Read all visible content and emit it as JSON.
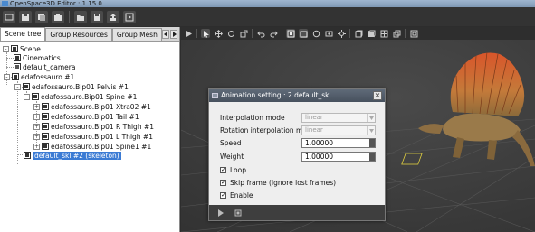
{
  "window": {
    "title": "OpenSpace3D Editor : 1.15.0"
  },
  "toolbar": {
    "buttons": [
      "scene-icon",
      "save-icon",
      "save-as-icon",
      "import-icon",
      "open-folder-icon",
      "calculator-icon",
      "export-icon",
      "run-icon"
    ]
  },
  "left_panel": {
    "tabs": [
      {
        "label": "Scene tree",
        "active": true
      },
      {
        "label": "Group Resources",
        "active": false
      },
      {
        "label": "Group Mesh",
        "active": false
      }
    ],
    "tree": [
      {
        "label": "Scene",
        "level": 0,
        "expander": "-"
      },
      {
        "label": "Cinematics",
        "level": 1,
        "expander": ""
      },
      {
        "label": "default_camera",
        "level": 1,
        "expander": ""
      },
      {
        "label": "edafossauro #1",
        "level": 1,
        "expander": "-"
      },
      {
        "label": "edafossauro.Bip01 Pelvis #1",
        "level": 2,
        "expander": "-"
      },
      {
        "label": "edafossauro.Bip01 Spine #1",
        "level": 3,
        "expander": "-"
      },
      {
        "label": "edafossauro.Bip01 Xtra02 #1",
        "level": 4,
        "expander": "+"
      },
      {
        "label": "edafossauro.Bip01 Tail #1",
        "level": 4,
        "expander": "+"
      },
      {
        "label": "edafossauro.Bip01 R Thigh #1",
        "level": 4,
        "expander": "+"
      },
      {
        "label": "edafossauro.Bip01 L Thigh #1",
        "level": 4,
        "expander": "+"
      },
      {
        "label": "edafossauro.Bip01 Spine1 #1",
        "level": 4,
        "expander": "+"
      },
      {
        "label": "default_skl #2 (skeleton)",
        "level": 2,
        "expander": "",
        "selected": true
      }
    ]
  },
  "viewport_toolbar": {
    "icons": [
      "play-icon",
      "select-icon",
      "move-icon",
      "rotate-icon",
      "scale-icon",
      "undo-icon",
      "redo-icon",
      "view-icon",
      "camera-icon",
      "light-icon",
      "shadow-icon",
      "settings-icon",
      "box-icon",
      "cube-icon",
      "grid-icon",
      "layers-icon",
      "shield-icon"
    ]
  },
  "dialog": {
    "title": "Animation setting : 2.default_skl",
    "close_label": "×",
    "fields": {
      "interpolation_mode": {
        "label": "Interpolation mode",
        "value": "linear"
      },
      "rotation_interpolation_mode": {
        "label": "Rotation interpolation mode",
        "value": "linear"
      },
      "speed": {
        "label": "Speed",
        "value": "1.00000"
      },
      "weight": {
        "label": "Weight",
        "value": "1.00000"
      }
    },
    "checkboxes": {
      "loop": {
        "label": "Loop",
        "checked": true
      },
      "skip_frame": {
        "label": "Skip frame (Ignore lost frames)",
        "checked": true
      },
      "enable": {
        "label": "Enable",
        "checked": true
      }
    },
    "footer_icons": [
      "play-icon",
      "stop-icon"
    ]
  },
  "colors": {
    "selection": "#3b7bd4",
    "viewport": "#3c3c3c",
    "dialog_title": "#525c69"
  }
}
